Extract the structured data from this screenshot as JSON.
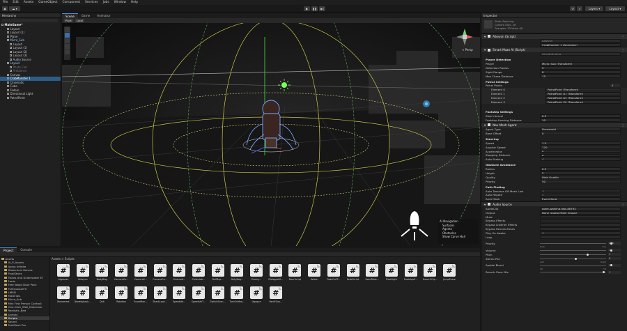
{
  "menubar": [
    "File",
    "Edit",
    "Assets",
    "GameObject",
    "Component",
    "Services",
    "Jobs",
    "Window",
    "Help"
  ],
  "toolbar": {
    "account": "Account",
    "layers": "Layers",
    "layout": "Layout"
  },
  "hierarchy": {
    "title": "Hierarchy",
    "items": [
      {
        "label": "MainGame*",
        "state": "bold"
      },
      {
        "label": "Layout",
        "state": ""
      },
      {
        "label": "Layout (1)",
        "state": ""
      },
      {
        "label": "Plane",
        "state": ""
      },
      {
        "label": "Micro_Sub",
        "state": "blue"
      },
      {
        "label": "Layout",
        "state": ""
      },
      {
        "label": "Layout (1)",
        "state": ""
      },
      {
        "label": "Layout (2)",
        "state": ""
      },
      {
        "label": "Layout (3)",
        "state": ""
      },
      {
        "label": "Audio Source",
        "state": ""
      },
      {
        "label": "Layout",
        "state": "blue"
      },
      {
        "label": "Photo Cell",
        "state": "dim"
      },
      {
        "label": "Ambiance",
        "state": "dim"
      },
      {
        "label": "Canvas",
        "state": ""
      },
      {
        "label": "CrabMonster 1",
        "state": "sel"
      },
      {
        "label": "Cinematic",
        "state": ""
      },
      {
        "label": "Cube",
        "state": ""
      },
      {
        "label": "Fadein",
        "state": ""
      },
      {
        "label": "Directional Light",
        "state": ""
      },
      {
        "label": "PatrolPoint",
        "state": ""
      }
    ]
  },
  "scene": {
    "tabs": [
      "Scene",
      "Game",
      "Animator"
    ],
    "toolbar": [
      "Pivot",
      "Local"
    ],
    "persp": "< Persp",
    "ai_navigation": {
      "title": "AI Navigation",
      "items": [
        "Surfaces",
        "Agents",
        "Obstacles",
        "Show Carve Hull"
      ]
    }
  },
  "project": {
    "tabs": [
      "Project",
      "Console"
    ],
    "breadcrumb": "Assets > Scripts",
    "tree": [
      "Assets",
      "AI_P_Assets",
      "Alpha Infinite",
      "Dialectical Games",
      "FinalStairs",
      "Fishes And Underwater Ef",
      "Fonts",
      "Free Wood Door Pack",
      "FullOpaqueFX",
      "LIBSD",
      "Materials",
      "Micro_Sub",
      "Mini First Person Controll",
      "One-Click_Wall_Materials",
      "Realistic_Bed",
      "Scenes",
      "Scripts",
      "Sound",
      "TextMesh Pro"
    ],
    "selected_folder": "Scripts",
    "assets": [
      "AIgaman",
      "Alikeyon",
      "BodyBlog",
      "CameraCo...",
      "CameraS...",
      "CameraCo...",
      "Cinemati...",
      "Collectab...",
      "DefMap...",
      "DirtyBag...",
      "Enemy...",
      "DialogueM...",
      "DoorScript",
      "Fadein",
      "FadeOutT...",
      "FadeScript",
      "FadeTable...",
      "Flashlight",
      "FootstepS...",
      "HoverOrSp...",
      "JumpScare",
      "Movement",
      "Nodekyback...",
      "Quit",
      "Rotation",
      "ScoreMan...",
      "SharkLook...",
      "SpeedVel...",
      "SpeedVelT...",
      "SwitchScen...",
      "TurnOnMed...",
      "Ugaque",
      "VentFGov..."
    ]
  },
  "inspector": {
    "title": "Inspector",
    "header_lines": [
      "Static Batching",
      "Camera Objs - 8f",
      "Triangles: 33 Verts: 68"
    ],
    "aikeyon": {
      "name": "Aikeyon (Script)",
      "script": "Aikeyon",
      "animator": "CrabMonster 1 (Animator)"
    },
    "smart_maze": {
      "name": "Smart Maze AI (Script)",
      "script": "AI pathfinding",
      "section": "Player Detection",
      "fields": [
        [
          "Player",
          "Micro_Sub (Transform)"
        ],
        [
          "Detection Radius",
          "5"
        ],
        [
          "Sight Range",
          "8"
        ],
        [
          "Max Chase Distance",
          "15"
        ]
      ],
      "patrol_title": "Patrol Settings",
      "patrol_points": "Patrol Points",
      "patrol_count": "4",
      "elements": [
        [
          "Element 0",
          "PatrolPoint (Transform)"
        ],
        [
          "Element 1",
          "PatrolPoint (1) (Transform)"
        ],
        [
          "Element 2",
          "PatrolPoint (2) (Transform)"
        ],
        [
          "Element 3",
          "PatrolPoint (3) (Transform)"
        ]
      ],
      "footstep_title": "Footstep Settings",
      "footstep": [
        [
          "Step Interval",
          "0.5"
        ],
        [
          "Footstep Hearing Distance",
          "10"
        ]
      ]
    },
    "nav": {
      "name": "Nav Mesh Agent",
      "fields": [
        [
          "Agent Type",
          "Humanoid"
        ],
        [
          "Base Offset",
          "0"
        ]
      ],
      "steering_title": "Steering",
      "steering": [
        [
          "Speed",
          "1.5"
        ],
        [
          "Angular Speed",
          "120"
        ],
        [
          "Acceleration",
          "8"
        ],
        [
          "Stopping Distance",
          "0"
        ],
        [
          "Auto Braking",
          "✓"
        ]
      ],
      "obstacle_title": "Obstacle Avoidance",
      "obstacle": [
        [
          "Radius",
          "0.5"
        ],
        [
          "Height",
          "2"
        ],
        [
          "Quality",
          "High Quality"
        ],
        [
          "Priority",
          "50"
        ]
      ],
      "path_title": "Path Finding",
      "path": [
        [
          "Auto Traverse Off Mesh Link",
          "✓"
        ],
        [
          "Auto Repath",
          "✓"
        ],
        [
          "Area Mask",
          "Everything"
        ]
      ]
    },
    "audio": {
      "name": "Audio Source",
      "fields": [
        [
          "AudioClip",
          "giant-walking-fast-88792"
        ],
        [
          "Output",
          "None (Audio Mixer Group)"
        ],
        [
          "Mute",
          ""
        ],
        [
          "Bypass Effects",
          ""
        ],
        [
          "Bypass Listener Effects",
          ""
        ],
        [
          "Bypass Reverb Zones",
          ""
        ],
        [
          "Play On Awake",
          "✓"
        ],
        [
          "Loop",
          ""
        ]
      ],
      "priority": {
        "label": "Priority",
        "value": "256",
        "left": "High",
        "right": "Low",
        "level": 1.0
      },
      "volume": {
        "label": "Volume",
        "value": "1",
        "level": 1.0
      },
      "pitch": {
        "label": "Pitch",
        "value": "1",
        "level": 0.67
      },
      "stereo": {
        "label": "Stereo Pan",
        "value": "0",
        "left": "Left",
        "right": "Right",
        "level": 0.5
      },
      "spatial": {
        "label": "Spatial Blend",
        "value": "1",
        "left": "2D",
        "right": "3D",
        "level": 1.0
      },
      "reverb": {
        "label": "Reverb Zone Mix",
        "value": "1",
        "level": 0.9
      }
    }
  }
}
